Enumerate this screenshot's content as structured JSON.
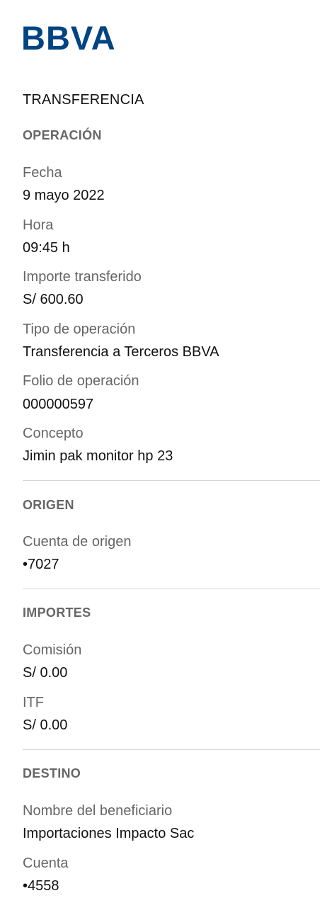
{
  "brand": {
    "logo_text": "BBVA",
    "color": "#004481"
  },
  "document": {
    "title": "TRANSFERENCIA"
  },
  "operacion": {
    "section_title": "OPERACIÓN",
    "fecha_label": "Fecha",
    "fecha_value": "9 mayo 2022",
    "hora_label": "Hora",
    "hora_value": "09:45 h",
    "importe_label": "Importe transferido",
    "importe_value": "S/ 600.60",
    "tipo_label": "Tipo de operación",
    "tipo_value": "Transferencia a Terceros BBVA",
    "folio_label": "Folio de operación",
    "folio_value": "000000597",
    "concepto_label": "Concepto",
    "concepto_value": "Jimin pak monitor hp 23"
  },
  "origen": {
    "section_title": "ORIGEN",
    "cuenta_label": "Cuenta de origen",
    "cuenta_value": "•7027"
  },
  "importes": {
    "section_title": "IMPORTES",
    "comision_label": "Comisión",
    "comision_value": "S/ 0.00",
    "itf_label": "ITF",
    "itf_value": "S/ 0.00"
  },
  "destino": {
    "section_title": "DESTINO",
    "beneficiario_label": "Nombre del beneficiario",
    "beneficiario_value": "Importaciones Impacto Sac",
    "cuenta_label": "Cuenta",
    "cuenta_value": "•4558"
  }
}
